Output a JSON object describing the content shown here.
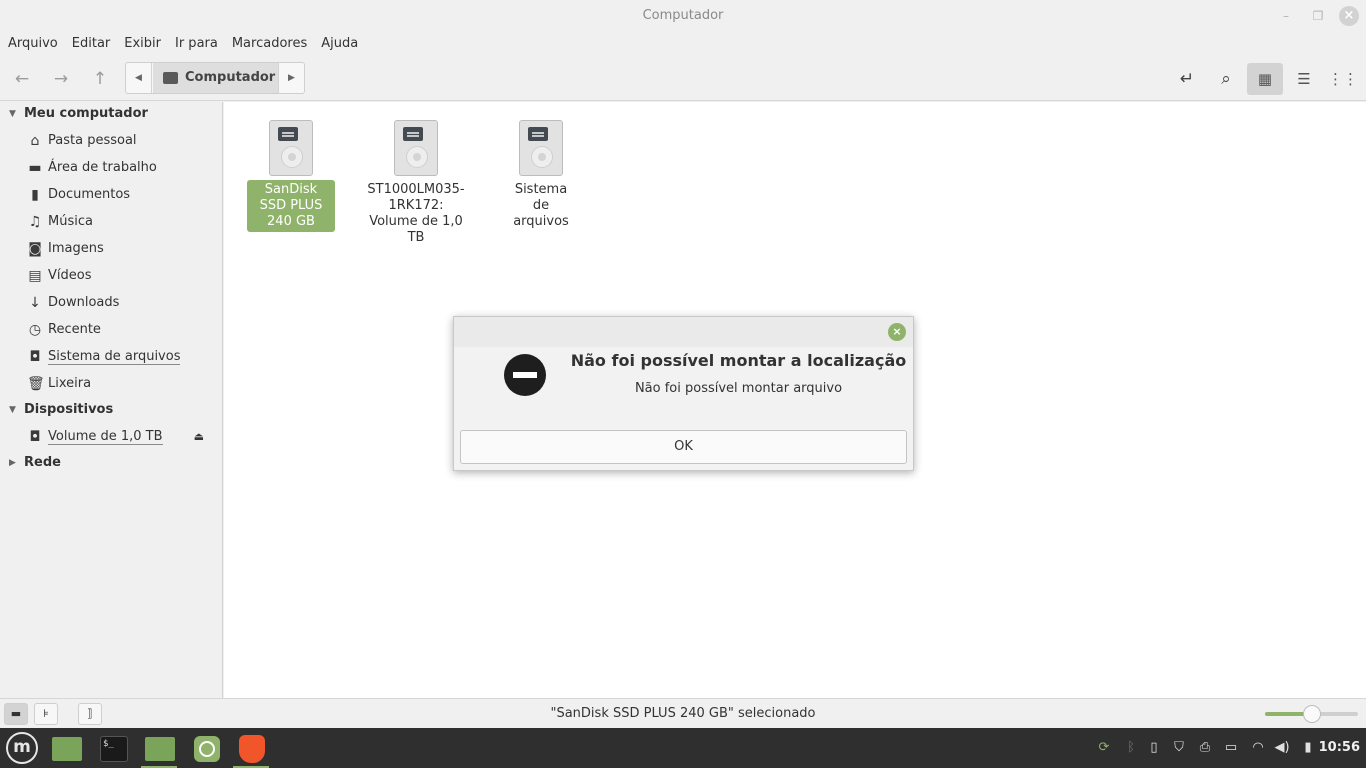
{
  "window": {
    "title": "Computador"
  },
  "menubar": [
    "Arquivo",
    "Editar",
    "Exibir",
    "Ir para",
    "Marcadores",
    "Ajuda"
  ],
  "toolbar": {
    "path_crumb": "Computador"
  },
  "sidebar": {
    "sections": {
      "computer": "Meu computador",
      "devices": "Dispositivos",
      "network": "Rede"
    },
    "computer_items": [
      {
        "label": "Pasta pessoal",
        "icon": "home-icon"
      },
      {
        "label": "Área de trabalho",
        "icon": "desktop-icon"
      },
      {
        "label": "Documentos",
        "icon": "document-icon"
      },
      {
        "label": "Música",
        "icon": "music-icon"
      },
      {
        "label": "Imagens",
        "icon": "camera-icon"
      },
      {
        "label": "Vídeos",
        "icon": "film-icon"
      },
      {
        "label": "Downloads",
        "icon": "download-icon"
      },
      {
        "label": "Recente",
        "icon": "recent-icon"
      },
      {
        "label": "Sistema de arquivos",
        "icon": "drive-icon"
      },
      {
        "label": "Lixeira",
        "icon": "trash-icon"
      }
    ],
    "device_items": [
      {
        "label": "Volume de 1,0 TB",
        "icon": "drive-icon"
      }
    ]
  },
  "content": {
    "drives": [
      {
        "name": "SanDisk SSD PLUS 240 GB",
        "selected": true
      },
      {
        "name": "ST1000LM035-1RK172: Volume de 1,0 TB",
        "selected": false
      },
      {
        "name": "Sistema de arquivos",
        "selected": false
      }
    ]
  },
  "status": {
    "text": "\"SanDisk SSD PLUS 240 GB\" selecionado",
    "zoom_fraction": 0.5
  },
  "dialog": {
    "title": "Não foi possível montar a localização",
    "message": "Não foi possível montar arquivo",
    "ok_label": "OK"
  },
  "taskbar": {
    "clock": "10:56"
  },
  "colors": {
    "accent": "#8fb36b",
    "taskbar": "#2f2f2f"
  }
}
